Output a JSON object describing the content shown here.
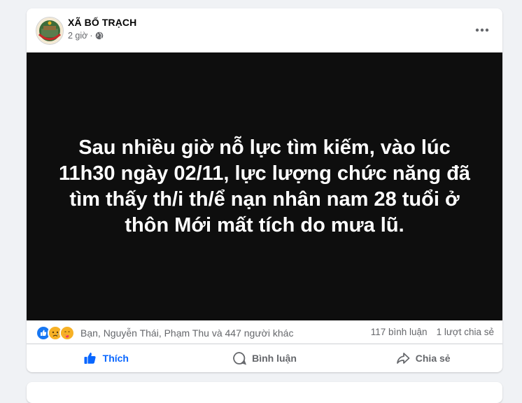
{
  "post": {
    "page_name": "XÃ BỐ TRẠCH",
    "time": "2 giờ",
    "separator": "·",
    "privacy_icon": "globe-icon",
    "more_icon": "more-horizontal-icon",
    "image_text": "Sau nhiều giờ nỗ lực tìm kiếm, vào lúc 11h30 ngày 02/11, lực lượng chức năng đã tìm thấy th/i th/ể nạn nhân nam 28 tuổi ở thôn Mới mất tích do mưa lũ.",
    "image_background": "#0e0e0e"
  },
  "stats": {
    "reaction_icons": [
      "like-reaction-icon",
      "sad-reaction-icon",
      "care-reaction-icon"
    ],
    "reaction_summary": "Bạn, Nguyễn Thái, Phạm Thu và 447 người khác",
    "comments": "117 bình luận",
    "shares": "1 lượt chia sẻ"
  },
  "actions": {
    "like_label": "Thích",
    "comment_label": "Bình luận",
    "share_label": "Chia sẻ",
    "like_active": true
  },
  "colors": {
    "accent": "#0866ff",
    "secondary_text": "#65676b",
    "page_background": "#f0f2f5"
  }
}
